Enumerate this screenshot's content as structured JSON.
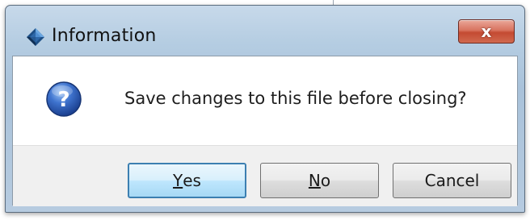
{
  "dialog": {
    "title": "Information",
    "close_label": "x",
    "message": "Save changes to this file before closing?"
  },
  "buttons": {
    "yes": {
      "mnemonic": "Y",
      "rest": "es"
    },
    "no": {
      "mnemonic": "N",
      "rest": "o"
    },
    "cancel": {
      "label": "Cancel"
    }
  },
  "icons": {
    "app": "diamond-app-icon",
    "message": "question-icon",
    "close": "close-icon"
  },
  "colors": {
    "titlebar": "#b5cde2",
    "close_button": "#c44a32",
    "question_icon": "#2b5cb8",
    "default_button_border": "#3c7fb1",
    "button_area": "#f0f0f0"
  }
}
